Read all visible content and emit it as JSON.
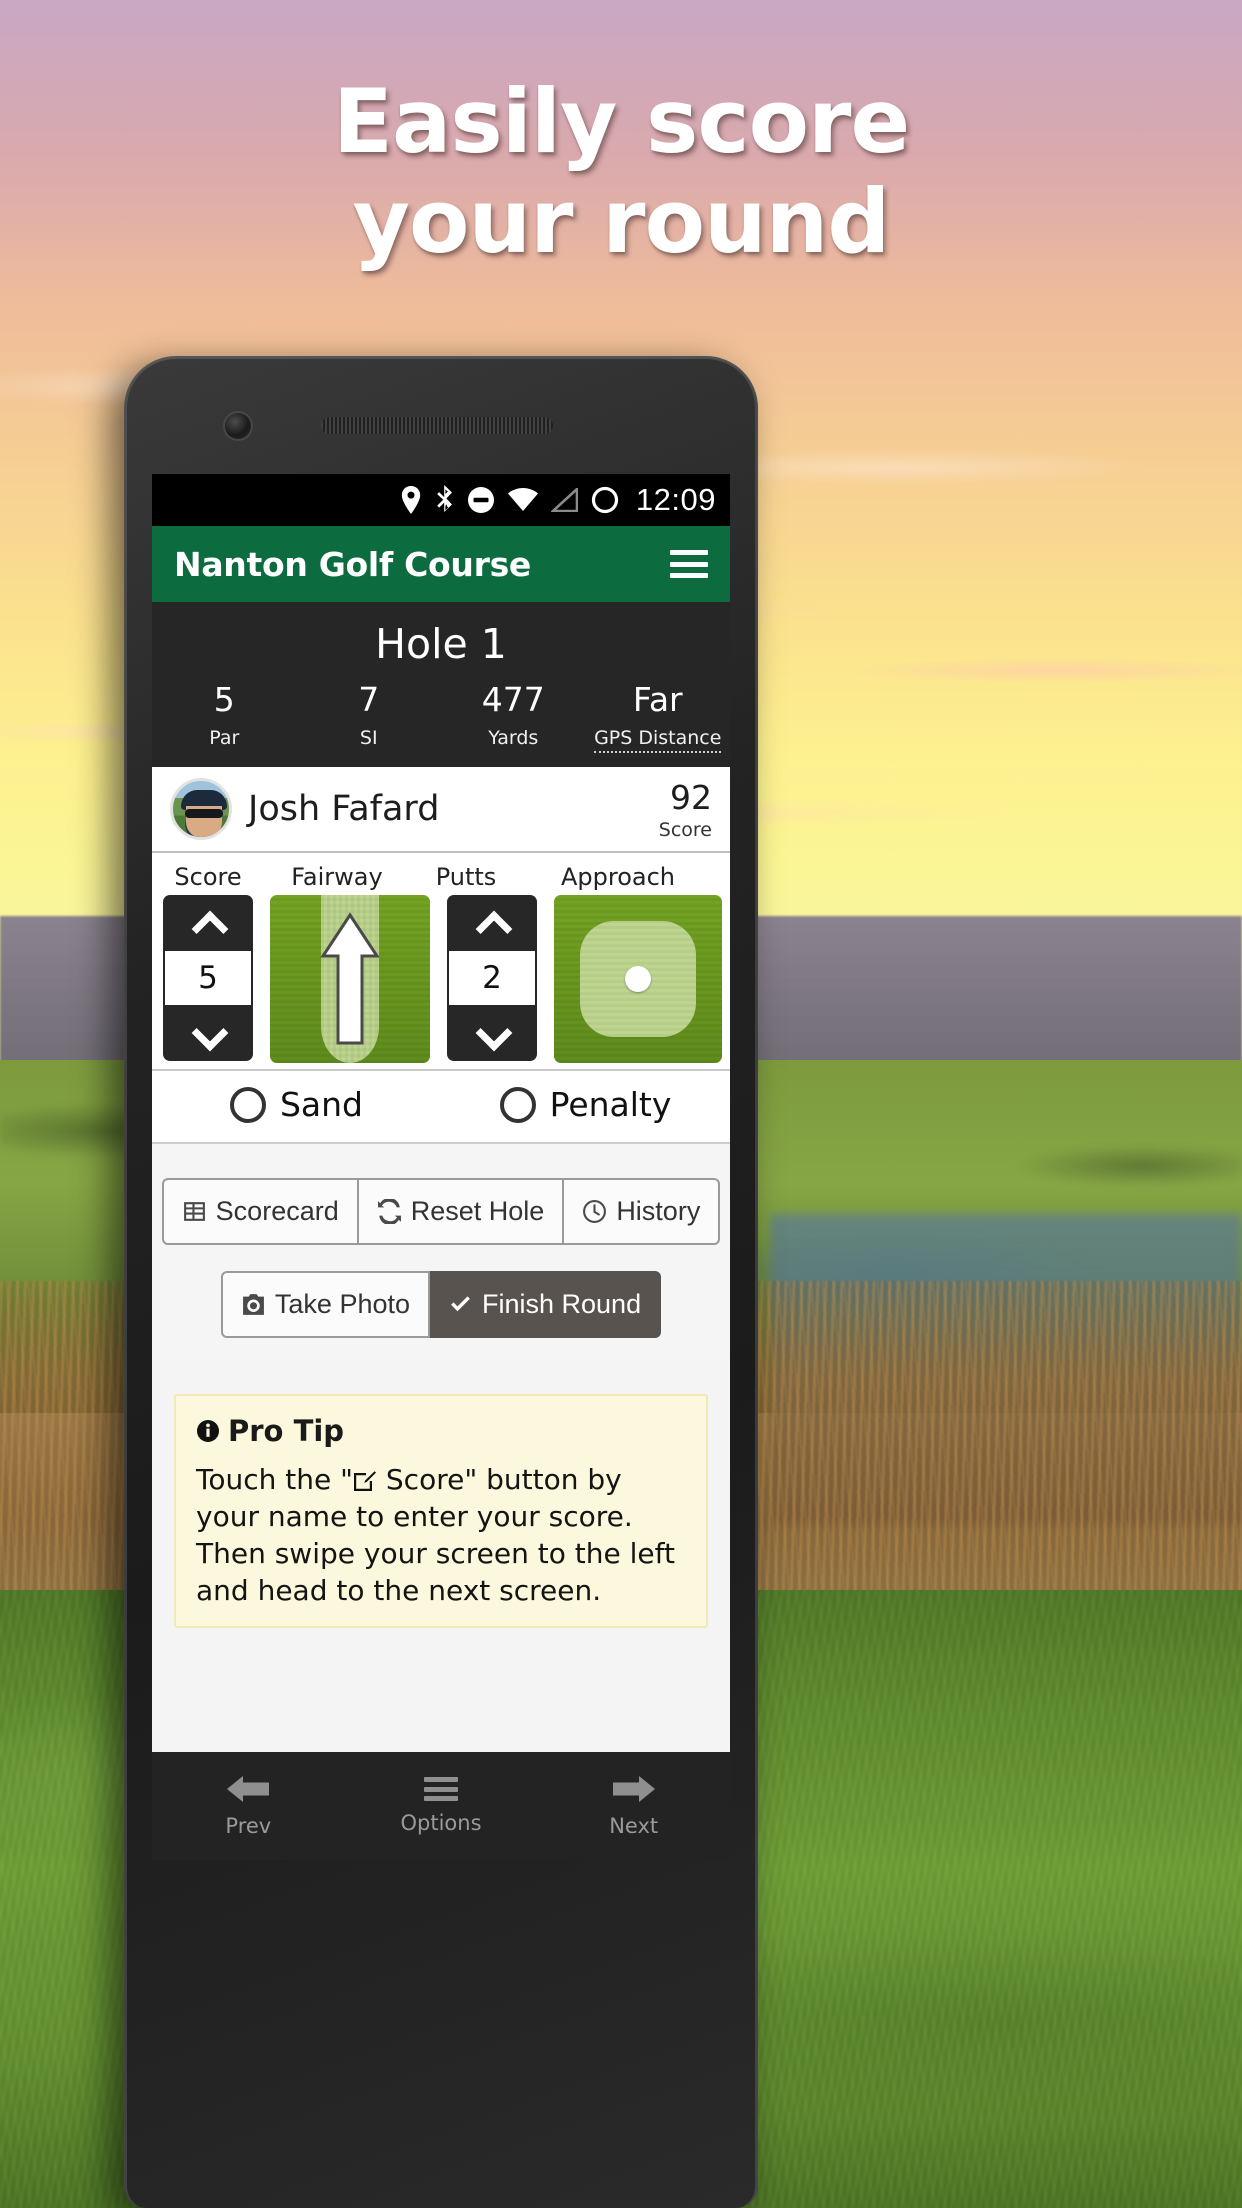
{
  "promo": {
    "line1": "Easily score",
    "line2": "your round"
  },
  "statusbar": {
    "icons": [
      "location-pin-icon",
      "bluetooth-icon",
      "do-not-disturb-icon",
      "wifi-icon",
      "signal-icon",
      "alarm-circle-icon"
    ],
    "time": "12:09"
  },
  "appbar": {
    "title": "Nanton Golf Course",
    "menu_icon": "hamburger-menu-icon"
  },
  "hole": {
    "title": "Hole 1",
    "stats": [
      {
        "value": "5",
        "label": "Par"
      },
      {
        "value": "7",
        "label": "SI"
      },
      {
        "value": "477",
        "label": "Yards"
      },
      {
        "value": "Far",
        "label": "GPS Distance"
      }
    ]
  },
  "player": {
    "name": "Josh Fafard",
    "score": "92",
    "score_label": "Score"
  },
  "controls": {
    "headers": [
      "Score",
      "Fairway",
      "Putts",
      "Approach"
    ],
    "score_value": "5",
    "putts_value": "2",
    "up_icon": "chevron-up-icon",
    "down_icon": "chevron-down-icon"
  },
  "flags": [
    {
      "label": "Sand",
      "checked": false
    },
    {
      "label": "Penalty",
      "checked": false
    }
  ],
  "actions": {
    "row1": [
      {
        "label": "Scorecard",
        "icon": "table-icon"
      },
      {
        "label": "Reset Hole",
        "icon": "refresh-icon"
      },
      {
        "label": "History",
        "icon": "clock-icon"
      }
    ],
    "row2": [
      {
        "label": "Take Photo",
        "icon": "camera-icon",
        "primary": false
      },
      {
        "label": "Finish Round",
        "icon": "check-icon",
        "primary": true
      }
    ]
  },
  "protip": {
    "heading": "Pro Tip",
    "icon": "info-circle-icon",
    "text_before": "Touch the \"",
    "inline_icon": "edit-score-icon",
    "text_after": " Score\" button by your name to enter your score. Then swipe your screen to the left and head to the next screen."
  },
  "bottomnav": [
    {
      "label": "Prev",
      "icon": "arrow-left-icon"
    },
    {
      "label": "Options",
      "icon": "hamburger-menu-icon"
    },
    {
      "label": "Next",
      "icon": "arrow-right-icon"
    }
  ],
  "colors": {
    "brand_green": "#0d6b40",
    "panel_dark": "#262626",
    "fairway_green": "#6d9c20",
    "tip_bg": "#fcf8dd"
  }
}
